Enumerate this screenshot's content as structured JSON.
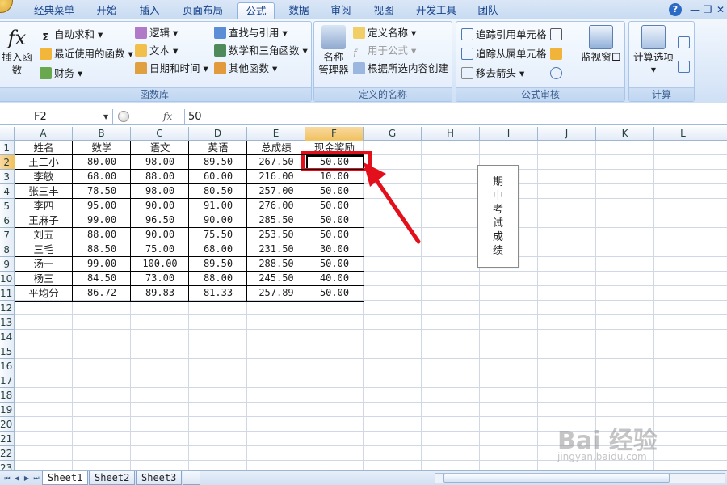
{
  "ribbon_tabs": [
    "经典菜单",
    "开始",
    "插入",
    "页面布局",
    "公式",
    "数据",
    "审阅",
    "视图",
    "开发工具",
    "团队"
  ],
  "active_tab": "公式",
  "window_controls": {
    "help": "?",
    "minimize": "—",
    "restore": "❐",
    "close": "✕"
  },
  "groups": {
    "function_library": {
      "label": "函数库",
      "insert_function": "插入函数",
      "items": [
        "自动求和 ▾",
        "最近使用的函数 ▾",
        "财务 ▾",
        "逻辑 ▾",
        "文本 ▾",
        "日期和时间 ▾",
        "查找与引用 ▾",
        "数学和三角函数 ▾",
        "其他函数 ▾"
      ]
    },
    "defined_names": {
      "label": "定义的名称",
      "name_manager": "名称\n管理器",
      "items": [
        "定义名称 ▾",
        "用于公式 ▾",
        "根据所选内容创建"
      ]
    },
    "formula_auditing": {
      "label": "公式审核",
      "items": [
        "追踪引用单元格",
        "追踪从属单元格",
        "移去箭头 ▾"
      ],
      "watch_window": "监视窗口"
    },
    "calculation": {
      "label": "计算",
      "calc_options": "计算选项"
    }
  },
  "formula_bar": {
    "name_box": "F2",
    "fx": "fx",
    "value": "50"
  },
  "columns": [
    "A",
    "B",
    "C",
    "D",
    "E",
    "F",
    "G",
    "H",
    "I",
    "J",
    "K",
    "L"
  ],
  "selected_column": "F",
  "selected_row": 2,
  "rows": [
    "1",
    "2",
    "3",
    "4",
    "5",
    "6",
    "7",
    "8",
    "9",
    "10",
    "11",
    "12",
    "13",
    "14",
    "15",
    "16",
    "17",
    "18",
    "19",
    "20",
    "21",
    "22",
    "23"
  ],
  "table": {
    "headers": [
      "姓名",
      "数学",
      "语文",
      "英语",
      "总成绩",
      "现金奖励"
    ],
    "rows": [
      [
        "王二小",
        "80.00",
        "98.00",
        "89.50",
        "267.50",
        "50.00"
      ],
      [
        "李敏",
        "68.00",
        "88.00",
        "60.00",
        "216.00",
        "10.00"
      ],
      [
        "张三丰",
        "78.50",
        "98.00",
        "80.50",
        "257.00",
        "50.00"
      ],
      [
        "李四",
        "95.00",
        "90.00",
        "91.00",
        "276.00",
        "50.00"
      ],
      [
        "王麻子",
        "99.00",
        "96.50",
        "90.00",
        "285.50",
        "50.00"
      ],
      [
        "刘五",
        "88.00",
        "90.00",
        "75.50",
        "253.50",
        "50.00"
      ],
      [
        "三毛",
        "88.50",
        "75.00",
        "68.00",
        "231.50",
        "30.00"
      ],
      [
        "汤一",
        "99.00",
        "100.00",
        "89.50",
        "288.50",
        "50.00"
      ],
      [
        "杨三",
        "84.50",
        "73.00",
        "88.00",
        "245.50",
        "40.00"
      ],
      [
        "平均分",
        "86.72",
        "89.83",
        "81.33",
        "257.89",
        "50.00"
      ]
    ]
  },
  "textbox_chars": [
    "期",
    "中",
    "考",
    "试",
    "成",
    "绩"
  ],
  "sheet_tabs": [
    "Sheet1",
    "Sheet2",
    "Sheet3"
  ],
  "active_sheet": "Sheet1",
  "watermark": {
    "main": "Bai 经验",
    "sub": "jingyan.baidu.com"
  },
  "colors": {
    "highlight_red": "#e3101b",
    "header_selected": "#f1c15f",
    "ribbon_blue": "#15428b"
  }
}
